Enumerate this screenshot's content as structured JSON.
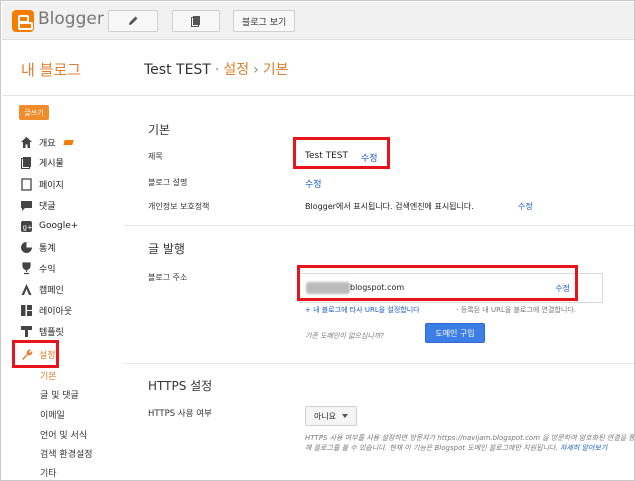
{
  "topbar": {
    "brand": "Blogger",
    "view_blog_label": "블로그 보기"
  },
  "header": {
    "my_blogs": "내 블로그",
    "blog_name": "Test TEST",
    "sep1": "·",
    "crumb_settings": "설정",
    "sep2": "›",
    "crumb_basic": "기본"
  },
  "sidebar": {
    "new_post": "글쓰기",
    "items": [
      {
        "label": "개요",
        "icon": "home-icon"
      },
      {
        "label": "게시물",
        "icon": "posts-icon"
      },
      {
        "label": "페이지",
        "icon": "pages-icon"
      },
      {
        "label": "댓글",
        "icon": "comments-icon"
      },
      {
        "label": "Google+",
        "icon": "google-plus-icon"
      },
      {
        "label": "통계",
        "icon": "stats-icon"
      },
      {
        "label": "수익",
        "icon": "earnings-icon"
      },
      {
        "label": "캠페인",
        "icon": "campaigns-icon"
      },
      {
        "label": "레이아웃",
        "icon": "layout-icon"
      },
      {
        "label": "템플릿",
        "icon": "template-icon"
      },
      {
        "label": "설정",
        "icon": "wrench-icon"
      }
    ],
    "sub_items": [
      "기본",
      "글 및 댓글",
      "이메일",
      "언어 및 서식",
      "검색 환경설정",
      "기타"
    ]
  },
  "basic": {
    "title": "기본",
    "title_label": "제목",
    "title_value": "Test TEST",
    "title_edit": "수정",
    "desc_label": "블로그 설명",
    "desc_edit": "수정",
    "privacy_label": "개인정보 보호정책",
    "privacy_value": "Blogger에서 표시됩니다. 검색엔진에 표시됩니다.",
    "privacy_edit": "수정"
  },
  "publishing": {
    "title": "글 발행",
    "address_label": "블로그 주소",
    "address_value": "blogspot.com",
    "address_edit": "수정",
    "custom_domain_link": "+ 내 블로그에 타사 URL을 설정합니다",
    "custom_domain_note": "- 등록된 내 URL을 블로그에 연결합니다.",
    "no_domain_q": "기존 도메인이 없으십니까?",
    "buy_domain": "도메인 구입"
  },
  "https": {
    "title": "HTTPS 설정",
    "availability_label": "HTTPS 사용 여부",
    "dropdown_value": "아니요",
    "note": "HTTPS 사용 여부를 사용 설정하면 방문자가 https://navijam.blogspot.com 을 방문하여 암호화된 연결을 통해 블로그를 볼 수 있습니다. 현재 이 기능은 Blogspot 도메인 블로그에만 지원됩니다.",
    "learn_more": "자세히 알아보기"
  },
  "colors": {
    "accent": "#e0802e",
    "highlight": "#e8141c",
    "link": "#1a5cc8",
    "button": "#3d7ee6"
  }
}
